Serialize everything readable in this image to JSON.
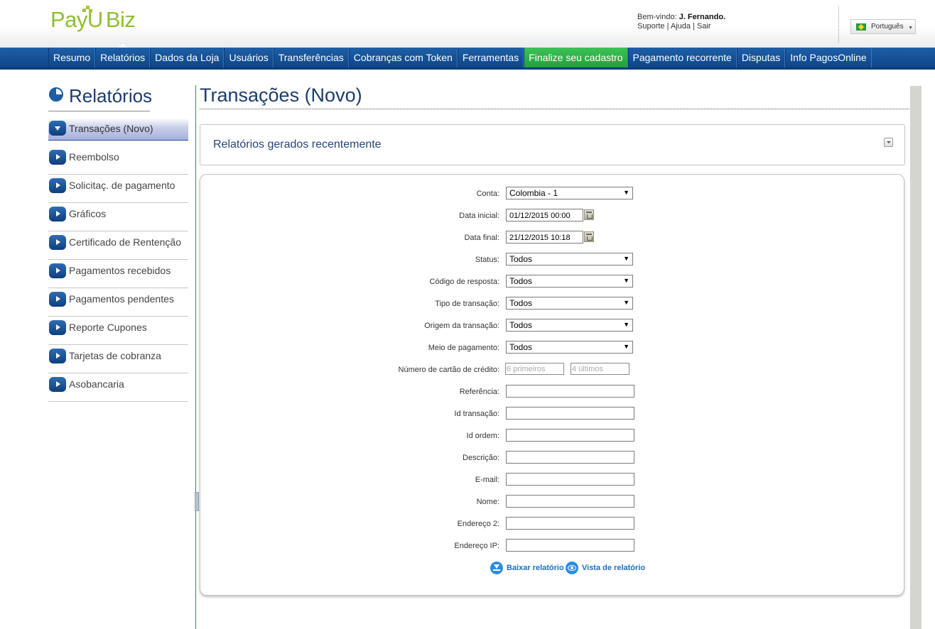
{
  "header": {
    "logo_payu": "PayU",
    "logo_biz": "Biz",
    "welcome_prefix": "Bem-vindo:",
    "user_name": "J. Fernando.",
    "links": [
      "Suporte",
      "Ajuda",
      "Sair"
    ],
    "language": "Português"
  },
  "nav": {
    "items": [
      {
        "label": "Resumo"
      },
      {
        "label": "Relatórios"
      },
      {
        "label": "Dados da Loja"
      },
      {
        "label": "Usuários"
      },
      {
        "label": "Transferências"
      },
      {
        "label": "Cobranças com Token"
      },
      {
        "label": "Ferramentas"
      },
      {
        "label": "Finalize seu cadastro"
      },
      {
        "label": "Pagamento recorrente"
      },
      {
        "label": "Disputas"
      },
      {
        "label": "Info PagosOnline"
      }
    ],
    "active": "Relatórios",
    "highlight": "Finalize seu cadastro",
    "colors": {
      "bar": "#1b559b",
      "highlight": "#2eb14b"
    }
  },
  "sidebar": {
    "title": "Relatórios",
    "items": [
      {
        "label": "Transações (Novo)",
        "active": true
      },
      {
        "label": "Reembolso"
      },
      {
        "label": "Solicitaç. de pagamento"
      },
      {
        "label": "Gráficos"
      },
      {
        "label": "Certificado de Rentenção"
      },
      {
        "label": "Pagamentos recebidos"
      },
      {
        "label": "Pagamentos pendentes"
      },
      {
        "label": "Reporte Cupones"
      },
      {
        "label": "Tarjetas de cobranza"
      },
      {
        "label": "Asobancaria"
      }
    ]
  },
  "main": {
    "title": "Transações (Novo)",
    "recent_reports_title": "Relatórios gerados recentemente"
  },
  "form": {
    "conta": {
      "label": "Conta:",
      "value": "Colombia - 1"
    },
    "data_inicial": {
      "label": "Data inicial:",
      "value": "01/12/2015 00:00"
    },
    "data_final": {
      "label": "Data final:",
      "value": "21/12/2015 10:18"
    },
    "status": {
      "label": "Status:",
      "value": "Todos"
    },
    "codigo_resposta": {
      "label": "Código de resposta:",
      "value": "Todos"
    },
    "tipo_transacao": {
      "label": "Tipo de transação:",
      "value": "Todos"
    },
    "origem_transacao": {
      "label": "Origem da transação:",
      "value": "Todos"
    },
    "meio_pagamento": {
      "label": "Meio de pagamento:",
      "value": "Todos"
    },
    "cartao": {
      "label": "Número de cartão de crédito:",
      "first_placeholder": "6 primeiros",
      "last_placeholder": "4 últimos"
    },
    "referencia": {
      "label": "Referência:",
      "value": ""
    },
    "id_transacao": {
      "label": "Id transação:",
      "value": ""
    },
    "id_ordem": {
      "label": "Id ordem:",
      "value": ""
    },
    "descricao": {
      "label": "Descrição:",
      "value": ""
    },
    "email": {
      "label": "E-mail:",
      "value": ""
    },
    "nome": {
      "label": "Nome:",
      "value": ""
    },
    "endereco2": {
      "label": "Endereço 2:",
      "value": ""
    },
    "endereco_ip": {
      "label": "Endereço IP:",
      "value": ""
    }
  },
  "actions": {
    "download": "Baixar relatório",
    "view": "Vista de relatório"
  },
  "icons": {
    "sidebar_title": "pie-chart-icon",
    "collapse": "chevron-down-icon",
    "calendar": "calendar-icon",
    "download": "download-icon",
    "view": "eye-icon",
    "flag": "brazil-flag-icon"
  }
}
